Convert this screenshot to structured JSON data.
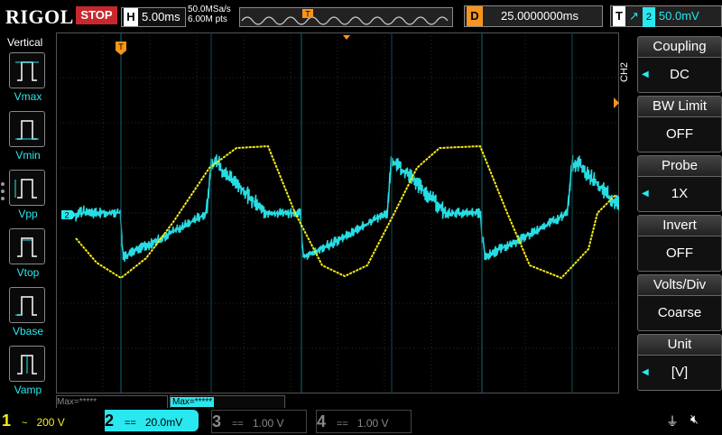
{
  "topbar": {
    "logo": "RIGOL",
    "run_state": "STOP",
    "timebase_tag": "H",
    "timebase": "5.00ms",
    "sample_rate": "50.0MSa/s",
    "memory_depth": "6.00M pts",
    "trigger_marker": "T",
    "delay_tag": "D",
    "delay": "25.0000000ms",
    "trigger_tag": "T",
    "trigger_edge": "↗",
    "trigger_source": "2",
    "trigger_level": "50.0mV"
  },
  "left_panel": {
    "title": "Vertical",
    "items": [
      {
        "label": "Vmax"
      },
      {
        "label": "Vmin"
      },
      {
        "label": "Vpp"
      },
      {
        "label": "Vtop"
      },
      {
        "label": "Vbase"
      },
      {
        "label": "Vamp"
      }
    ]
  },
  "right_menu": {
    "channel_tab": "CH2",
    "items": [
      {
        "header": "Coupling",
        "value": "DC"
      },
      {
        "header": "BW Limit",
        "value": "OFF"
      },
      {
        "header": "Probe",
        "value": "1X"
      },
      {
        "header": "Invert",
        "value": "OFF"
      },
      {
        "header": "Volts/Div",
        "value": "Coarse"
      },
      {
        "header": "Unit",
        "value": "[V]"
      }
    ]
  },
  "stats": {
    "ch1": "Max=*****",
    "ch2": "Max=*****"
  },
  "channels": [
    {
      "num": "1",
      "coupling": "~",
      "scale": "200 V",
      "color": "#f7ec13"
    },
    {
      "num": "2",
      "coupling": "==",
      "scale": "20.0mV",
      "color": "#29e8ef"
    },
    {
      "num": "3",
      "coupling": "==",
      "scale": "1.00 V",
      "color": "#888888"
    },
    {
      "num": "4",
      "coupling": "==",
      "scale": "1.00 V",
      "color": "#888888"
    }
  ],
  "markers": {
    "ch2_ground": "2"
  },
  "colors": {
    "ch1": "#f7ec13",
    "ch2": "#29e8ef",
    "stop": "#c8272c",
    "trigger": "#f7941d"
  }
}
